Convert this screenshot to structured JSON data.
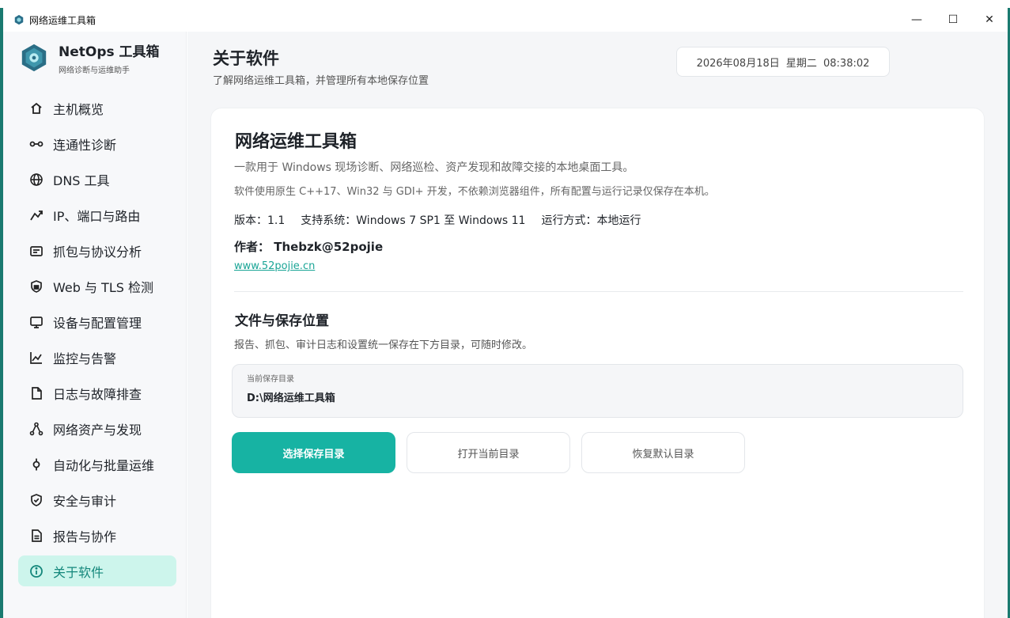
{
  "window": {
    "title": "网络运维工具箱",
    "controls": {
      "minimize": "—",
      "maximize": "☐",
      "close": "✕"
    }
  },
  "brand": {
    "name": "NetOps 工具箱",
    "subtitle": "网络诊断与运维助手"
  },
  "sidebar": {
    "items": [
      {
        "label": "主机概览",
        "icon": "home-icon"
      },
      {
        "label": "连通性诊断",
        "icon": "link-icon"
      },
      {
        "label": "DNS 工具",
        "icon": "globe-icon"
      },
      {
        "label": "IP、端口与路由",
        "icon": "route-icon"
      },
      {
        "label": "抓包与协议分析",
        "icon": "packet-icon"
      },
      {
        "label": "Web 与 TLS 检测",
        "icon": "shield-lock-icon"
      },
      {
        "label": "设备与配置管理",
        "icon": "monitor-icon"
      },
      {
        "label": "监控与告警",
        "icon": "chart-icon"
      },
      {
        "label": "日志与故障排查",
        "icon": "file-icon"
      },
      {
        "label": "网络资产与发现",
        "icon": "topology-icon"
      },
      {
        "label": "自动化与批量运维",
        "icon": "node-icon"
      },
      {
        "label": "安全与审计",
        "icon": "shield-check-icon"
      },
      {
        "label": "报告与协作",
        "icon": "report-icon"
      },
      {
        "label": "关于软件",
        "icon": "info-icon",
        "active": true
      }
    ]
  },
  "header": {
    "title": "关于软件",
    "subtitle": "了解网络运维工具箱，并管理所有本地保存位置",
    "datetime": "2026年08月18日 星期二 08:38:02"
  },
  "about": {
    "name": "网络运维工具箱",
    "desc1": "一款用于 Windows 现场诊断、网络巡检、资产发现和故障交接的本地桌面工具。",
    "desc2": "软件使用原生 C++17、Win32 与 GDI+ 开发，不依赖浏览器组件，所有配置与运行记录仅保存在本机。",
    "version": "版本：1.1",
    "system": "支持系统：Windows 7 SP1 至 Windows 11",
    "mode": "运行方式：本地运行",
    "author": "作者：  Thebzk@52pojie",
    "link": "www.52pojie.cn"
  },
  "storage": {
    "title": "文件与保存位置",
    "desc": "报告、抓包、审计日志和设置统一保存在下方目录，可随时修改。",
    "path_label": "当前保存目录",
    "path_value": "D:\\网络运维工具箱",
    "btn_choose": "选择保存目录",
    "btn_open": "打开当前目录",
    "btn_reset": "恢复默认目录"
  },
  "colors": {
    "accent": "#17b3a3",
    "active_bg": "#cdf5ec",
    "frame": "#1a7a70"
  }
}
